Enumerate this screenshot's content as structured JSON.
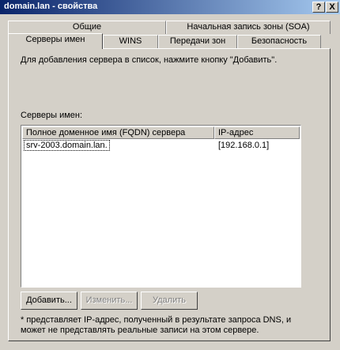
{
  "window": {
    "title": "domain.lan - свойства",
    "help_btn": "?",
    "close_btn": "X"
  },
  "tabs": {
    "row_back": [
      "Общие",
      "Начальная запись зоны (SOA)"
    ],
    "row_front": [
      "Серверы имен",
      "WINS",
      "Передачи зон",
      "Безопасность"
    ],
    "active": "Серверы имен"
  },
  "content": {
    "instruction": "Для добавления сервера в список, нажмите кнопку \"Добавить\".",
    "list_label": "Серверы имен:",
    "columns": [
      "Полное доменное имя (FQDN) сервера",
      "IP-адрес"
    ],
    "rows": [
      {
        "fqdn": "srv-2003.domain.lan.",
        "ip": "[192.168.0.1]"
      }
    ],
    "buttons": {
      "add": "Добавить...",
      "edit": "Изменить...",
      "delete": "Удалить"
    },
    "footnote_line1": "* представляет IP-адрес, полученный в результате запроса DNS, и",
    "footnote_line2": "может не представлять реальные записи на этом сервере."
  }
}
